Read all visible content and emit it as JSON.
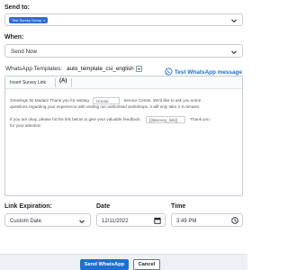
{
  "send_to": {
    "label": "Send to:",
    "tags": [
      "Test Survey Group"
    ],
    "tag_remove_glyph": "×"
  },
  "when": {
    "label": "When:",
    "value": "Send Now"
  },
  "whatsapp_templates": {
    "label": "WhatsApp Templates:",
    "value": "auto_template_csi_english"
  },
  "test_whatsapp": {
    "label": "Test WhatsApp message",
    "icon": "whatsapp-icon",
    "color": "#1d6fd1"
  },
  "editor": {
    "toolbar": {
      "insert_survey_link": "Insert Survey Link",
      "font_icon_glyph": "(A)"
    },
    "line1_before": "Greetings Sir,Madam Thank you for visiting",
    "line1_input": "Honda",
    "line1_after": "Service Center. We'd like to ask you some",
    "line2": "questions regarding your experience with visiting our authorised workshops. it will only take 2-3 minutes",
    "line3_before": "If you are okay, please hit the link below to give your valuable feedback:",
    "line3_input": "{{$survey_link}}",
    "line3_after": "Thank you",
    "line4": "for your attention"
  },
  "link_expiration": {
    "label": "Link Expiration:",
    "value": "Custom Date"
  },
  "date": {
    "label": "Date",
    "value": "12/11/2022"
  },
  "time": {
    "label": "Time",
    "value": "3:49 PM"
  },
  "footer": {
    "send_label": "Send WhatsApp",
    "cancel_label": "Cancel"
  },
  "colors": {
    "primary": "#1d6fd1",
    "tag": "#2f6bd4",
    "footer_bg": "#edf0f4"
  }
}
